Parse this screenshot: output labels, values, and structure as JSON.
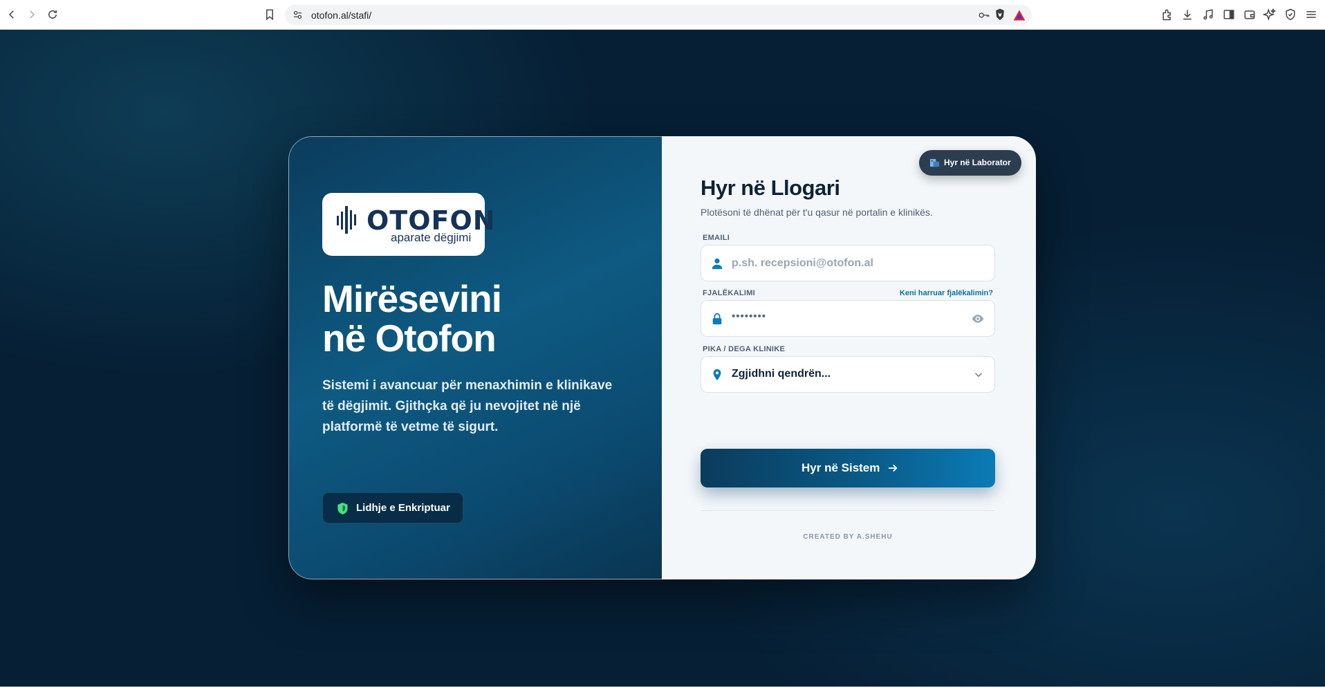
{
  "browser": {
    "url": "otofon.al/stafi/",
    "icons": [
      "back-icon",
      "forward-icon",
      "reload-icon",
      "bookmark-icon",
      "site-settings-icon",
      "key-icon",
      "brave-shield-icon",
      "rewards-icon",
      "extensions-icon",
      "download-icon",
      "media-icon",
      "sidebar-icon",
      "wallet-icon",
      "leo-ai-icon",
      "vpn-icon",
      "menu-icon"
    ]
  },
  "brand": {
    "logo_word": "OTOFON",
    "logo_tagline": "aparate dëgjimi"
  },
  "hero": {
    "title_line1": "Mirësevini",
    "title_line2": "në Otofon",
    "description": "Sistemi i avancuar për menaxhimin e klinikave të dëgjimit. Gjithçka që ju nevojitet në një platformë të vetme të sigurt.",
    "secure_badge": "Lidhje e Enkriptuar"
  },
  "form": {
    "lab_button": "Hyr në Laborator",
    "title": "Hyr në Llogari",
    "subtitle": "Plotësoni të dhënat për t'u qasur në portalin e klinikës.",
    "email_label": "EMAILI",
    "email_placeholder": "p.sh. recepsioni@otofon.al",
    "password_label": "FJALËKALIMI",
    "forgot_link": "Keni harruar fjalëkalimin?",
    "password_mask": "••••••••",
    "branch_label": "PIKA / DEGA KLINIKE",
    "branch_selected": "Zgjidhni qendrën...",
    "submit_label": "Hyr në Sistem",
    "credit": "CREATED BY A.SHEHU"
  },
  "colors": {
    "page_bg": "#061f35",
    "panel_accent": "#0e5a82",
    "form_bg": "#f4f7fa",
    "link": "#0a6fa8",
    "shield_green": "#4ade80",
    "brand_navy": "#143357"
  }
}
